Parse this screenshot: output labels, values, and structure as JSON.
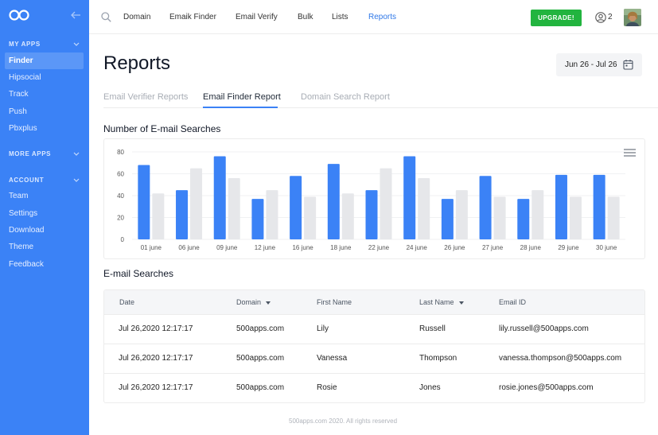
{
  "sidebar": {
    "sections": {
      "my_apps": "MY APPS",
      "more_apps": "MORE APPS",
      "account": "ACCOUNT"
    },
    "apps": [
      {
        "label": "Finder",
        "active": true
      },
      {
        "label": "Hipsocial"
      },
      {
        "label": "Track"
      },
      {
        "label": "Push"
      },
      {
        "label": "Pbxplus"
      }
    ],
    "account_items": [
      {
        "label": "Team"
      },
      {
        "label": "Settings"
      },
      {
        "label": "Download"
      },
      {
        "label": "Theme"
      },
      {
        "label": "Feedback"
      }
    ]
  },
  "topbar": {
    "nav": [
      {
        "label": "Domain"
      },
      {
        "label": "Emaik Finder"
      },
      {
        "label": "Email Verify"
      },
      {
        "label": "Bulk"
      },
      {
        "label": "Lists"
      },
      {
        "label": "Reports",
        "active": true
      }
    ],
    "upgrade_label": "UPGRADE!",
    "user_count": "2"
  },
  "page": {
    "title": "Reports",
    "date_range": "Jun 26 - Jul 26",
    "tabs": [
      {
        "label": "Email Verifier Reports"
      },
      {
        "label": "Email Finder Report",
        "active": true
      },
      {
        "label": "Domain Search Report"
      }
    ],
    "chart_title": "Number of E-mail Searches",
    "table_title": "E-mail Searches",
    "footer": "500apps.com 2020. All rights reserved"
  },
  "colors": {
    "sidebar": "#3b82f6",
    "accent": "#2f78e8",
    "bar_primary": "#3b82f6",
    "bar_secondary": "#e6e7ea",
    "upgrade": "#22b43f"
  },
  "chart_data": {
    "type": "bar",
    "categories": [
      "01 june",
      "06 june",
      "09 june",
      "12 june",
      "16 june",
      "18  june",
      "22 june",
      "24 june",
      "26 june",
      "27 june",
      "28 june",
      "29 june",
      "30 june"
    ],
    "series": [
      {
        "values": [
          68,
          45,
          76,
          37,
          58,
          69,
          45,
          76,
          37,
          58,
          37,
          59,
          59
        ]
      },
      {
        "values": [
          42,
          65,
          56,
          45,
          39,
          42,
          65,
          56,
          45,
          39,
          45,
          39,
          39
        ]
      }
    ],
    "ylim": [
      0,
      80
    ],
    "yticks": [
      0,
      20,
      40,
      60,
      80
    ],
    "grid": true,
    "legend": "none"
  },
  "table": {
    "columns": [
      {
        "label": "Date",
        "sortable": false
      },
      {
        "label": "Domain",
        "sortable": true
      },
      {
        "label": "First Name",
        "sortable": false
      },
      {
        "label": "Last Name",
        "sortable": true
      },
      {
        "label": "Email ID",
        "sortable": false
      }
    ],
    "rows": [
      [
        "Jul 26,2020 12:17:17",
        "500apps.com",
        "Lily",
        "Russell",
        "lily.russell@500apps.com"
      ],
      [
        "Jul 26,2020 12:17:17",
        "500apps.com",
        "Vanessa",
        "Thompson",
        "vanessa.thompson@500apps.com"
      ],
      [
        "Jul 26,2020 12:17:17",
        "500apps.com",
        "Rosie",
        "Jones",
        "rosie.jones@500apps.com"
      ]
    ]
  }
}
